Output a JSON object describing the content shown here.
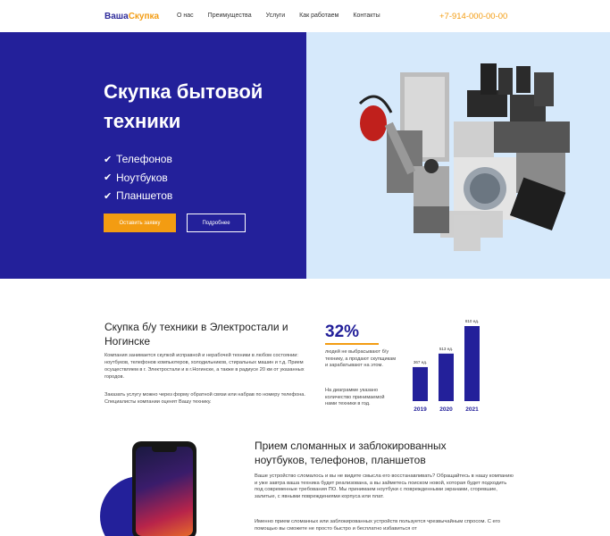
{
  "header": {
    "logo_part1": "Ваша",
    "logo_part2": "Скупка",
    "nav": [
      "О нас",
      "Преимущества",
      "Услуги",
      "Как работаем",
      "Контакты"
    ],
    "phone": "+7-914-000-00-00"
  },
  "hero": {
    "title": "Скупка бытовой техники",
    "items": [
      "Телефонов",
      "Ноутбуков",
      "Планшетов"
    ],
    "primary_button": "Оставить заявку",
    "secondary_button": "Подробнее"
  },
  "about": {
    "title": "Скупка б/у техники в Электростали и Ногинске",
    "p1": "Компания занимается скупкой исправной и нерабочей техники в любом состоянии: ноутбуков, телефонов компьютеров, холодильников, стиральных машин и т.д. Прием осуществляем в г. Электростали и в г.Ногинске, а также в радиусе 20 км от указанных городов.",
    "p2": "Заказать услугу можно через форму обратной связи или набрав по номеру телефона. Специалисты компании оценят Вашу технику.",
    "percent": "32%",
    "percent_text": "людей не выбрасывают б/у технику, а продают скупщикам и зарабатывают на этом.",
    "chart_text": "На диаграмме указано количество принимаемой нами техники в год."
  },
  "chart_data": {
    "type": "bar",
    "categories": [
      "2019",
      "2020",
      "2021"
    ],
    "values": [
      367,
      513,
      810
    ],
    "data_labels": [
      "367 ед.",
      "513 ед.",
      "810 ед."
    ],
    "ylim": [
      0,
      810
    ],
    "bar_color": "#23209a",
    "label_color": "#23209a"
  },
  "repair": {
    "title": "Прием сломанных и заблокированных ноутбуков, телефонов, планшетов",
    "p1": "Ваше устройство сломалось и вы не видите смысла его восстанавливать? Обращайтесь в нашу компанию и уже завтра ваша техника будет реализована, а вы займетесь поиском новой, которая будет подходить под современные требования ПО. Мы принимаем ноутбуки с поврежденными экранами, сгоревшие, залитые, с явными повреждениями корпуса или плат.",
    "p2": "Именно прием сломанных или заблокированных устройств пользуется чрезвычайным спросом. С его помощью вы сможете не просто быстро и бесплатно избавиться от"
  },
  "colors": {
    "brand_blue": "#23209a",
    "accent_orange": "#f39c12",
    "hero_right_bg": "#d6e9fb"
  }
}
